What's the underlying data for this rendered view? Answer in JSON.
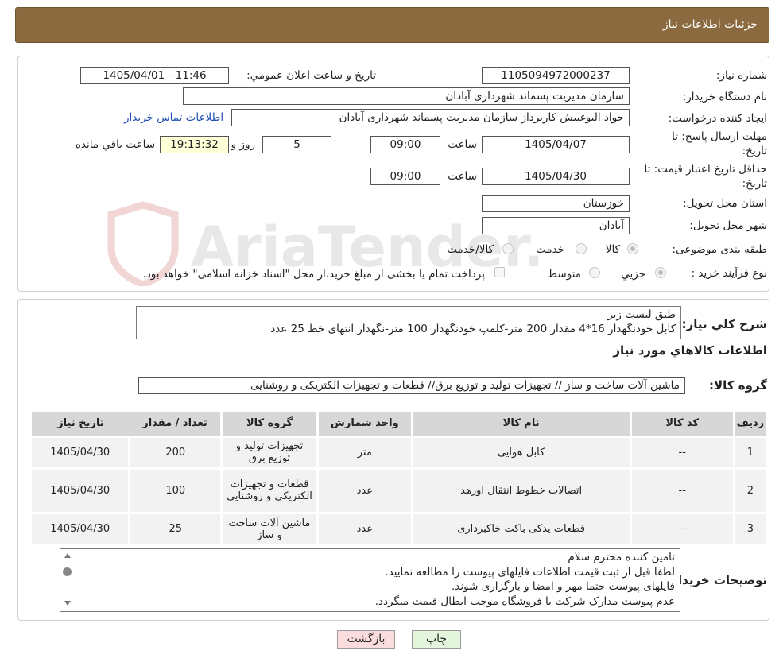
{
  "header": {
    "title": "جزئیات اطلاعات نیاز"
  },
  "watermark": {
    "text": "AriaTender.neT"
  },
  "fields": {
    "need_number_label": "شماره نیاز:",
    "need_number": "1105094972000237",
    "announce_label": "تاریخ و ساعت اعلان عمومي:",
    "announce_value": "1405/04/01 - 11:46",
    "buyer_org_label": "نام دستگاه خریدار:",
    "buyer_org": "سازمان مدیریت پسماند شهرداری آبادان",
    "creator_label": "ایجاد کننده درخواست:",
    "creator": "جواد البوغبیش کاربرداز سازمان مدیریت پسماند شهرداری آبادان",
    "contact_link": "اطلاعات تماس خریدار",
    "deadline_label_1": "مهلت ارسال پاسخ: تا",
    "deadline_label_2": "تاریخ:",
    "deadline_date": "1405/04/07",
    "time_label": "ساعت",
    "deadline_time": "09:00",
    "days_value": "5",
    "days_label": "روز و",
    "remaining_time": "19:13:32",
    "remaining_label": "ساعت باقي مانده",
    "validity_label_1": "حداقل تاریخ اعتبار قیمت: تا",
    "validity_label_2": "تاریخ:",
    "validity_date": "1405/04/30",
    "validity_time": "09:00",
    "province_label": "استان محل تحویل:",
    "province": "خوزستان",
    "city_label": "شهر محل تحویل:",
    "city": "آبادان",
    "category_label": "طبقه بندی موضوعی:",
    "category_options": [
      "کالا",
      "خدمت",
      "کالا/خدمت"
    ],
    "process_label": "نوع فرآیند خرید :",
    "process_options": [
      "جزيي",
      "متوسط"
    ],
    "process_note": "پرداخت تمام یا بخشی از مبلغ خرید،از محل \"اسناد خزانه اسلامی\" خواهد بود."
  },
  "summary": {
    "label": "شرح کلي نیاز:",
    "line1": "طبق لیست زیر",
    "line2": "کابل خودنگهدار 16*4 مقدار 200 متر-کلمپ خودنگهدار 100 متر-نگهدار انتهای خط 25 عدد"
  },
  "goods_info_title": "اطلاعات کالاهاي مورد نیاز",
  "goods_group": {
    "label": "گروه کالا:",
    "value": "ماشین آلات ساخت و ساز // تجهیزات تولید و توزیع برق// قطعات و تجهیزات الکتریکی و روشنایی"
  },
  "table": {
    "headers": [
      "ردیف",
      "کد کالا",
      "نام کالا",
      "واحد شمارش",
      "گروه کالا",
      "تعداد / مقدار",
      "تاریخ نیاز"
    ],
    "rows": [
      {
        "row": "1",
        "code": "--",
        "name": "کابل هوایی",
        "unit": "متر",
        "group": "تجهیزات تولید و توزیع برق",
        "qty": "200",
        "date": "1405/04/30"
      },
      {
        "row": "2",
        "code": "--",
        "name": "اتصالات خطوط انتقال اورهد",
        "unit": "عدد",
        "group": "قطعات و تجهیزات الکتریکی و روشنایی",
        "qty": "100",
        "date": "1405/04/30"
      },
      {
        "row": "3",
        "code": "--",
        "name": "قطعات یدکی باکت خاکبرداری",
        "unit": "عدد",
        "group": "ماشین آلات ساخت و ساز",
        "qty": "25",
        "date": "1405/04/30"
      }
    ]
  },
  "buyer_notes": {
    "label": "توضیحات خریدار:",
    "lines": [
      "تامین کننده محترم سلام",
      "لطفا قبل از ثبت قیمت اطلاعات فایلهای پیوست را مطالعه نمایید.",
      "فایلهای پیوست حتما مهر و امضا و بارگزاری شوند.",
      "عدم پیوست مدارک شرکت یا فروشگاه موجب ابطال قیمت میگردد."
    ]
  },
  "buttons": {
    "print": "چاپ",
    "back": "بازگشت"
  },
  "colors": {
    "header_bg": "#8a6a3e",
    "link": "#1f4fb3",
    "back_bg": "#fbdcdc",
    "print_bg": "#e3f5dc"
  }
}
